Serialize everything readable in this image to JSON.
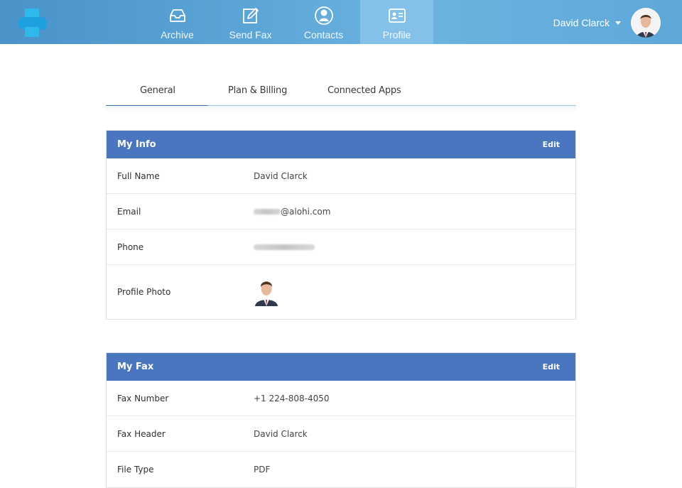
{
  "header": {
    "nav": [
      {
        "label": "Archive",
        "icon": "inbox-tray-icon",
        "active": false
      },
      {
        "label": "Send Fax",
        "icon": "edit-pencil-icon",
        "active": false
      },
      {
        "label": "Contacts",
        "icon": "person-circle-icon",
        "active": false
      },
      {
        "label": "Profile",
        "icon": "id-card-icon",
        "active": true
      }
    ],
    "user_name": "David Clarck",
    "colors": {
      "bar": "#5aa4d6",
      "active_tab": "#84c0e8"
    }
  },
  "tabs": [
    {
      "label": "General",
      "active": true
    },
    {
      "label": "Plan & Billing",
      "active": false
    },
    {
      "label": "Connected Apps",
      "active": false
    }
  ],
  "my_info": {
    "title": "My Info",
    "edit_label": "Edit",
    "rows": [
      {
        "label": "Full Name",
        "value": "David Clarck"
      },
      {
        "label": "Email",
        "value": "@alohi.com"
      },
      {
        "label": "Phone",
        "value": ""
      },
      {
        "label": "Profile Photo",
        "value": ""
      }
    ]
  },
  "my_fax": {
    "title": "My Fax",
    "edit_label": "Edit",
    "rows": [
      {
        "label": "Fax Number",
        "value": "+1 224-808-4050"
      },
      {
        "label": "Fax Header",
        "value": "David Clarck"
      },
      {
        "label": "File Type",
        "value": "PDF"
      }
    ]
  },
  "colors": {
    "card_header": "#4a76bf",
    "tab_underline": "#3c78c0"
  }
}
